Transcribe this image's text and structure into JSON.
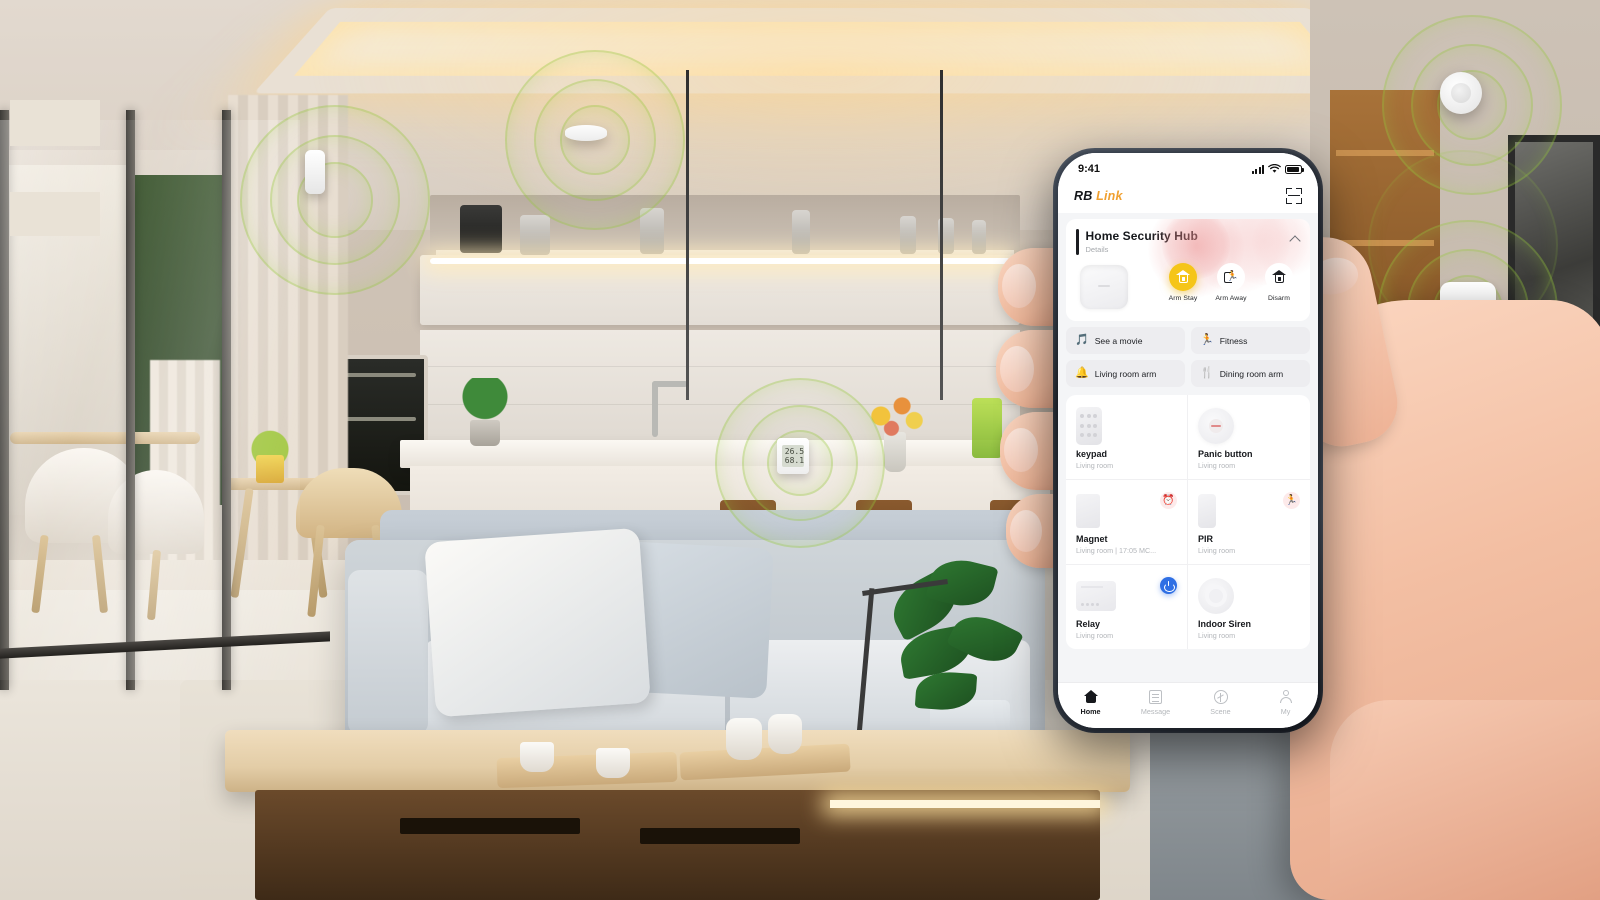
{
  "scene": {
    "description": "Modern living room with smart home sensors",
    "sensors": [
      {
        "name": "door-window-sensor",
        "location": "left wall"
      },
      {
        "name": "smoke-detector",
        "location": "ceiling"
      },
      {
        "name": "temperature-humidity-sensor",
        "location": "kitchen counter",
        "display": "26.5\n68.1"
      },
      {
        "name": "motion-sensor",
        "location": "right wall upper"
      },
      {
        "name": "wall-panel-sensor",
        "location": "right wall lower"
      }
    ],
    "accent_ring_color": "#96c83c"
  },
  "phone": {
    "status_bar": {
      "time": "9:41",
      "signal_icon": "cellular-signal-icon",
      "wifi_icon": "wifi-icon",
      "battery_icon": "battery-full-icon"
    },
    "header": {
      "brand_prefix": "RB",
      "brand_suffix": " Link",
      "scan_icon": "scan-qr-icon"
    },
    "hub": {
      "title": "Home Security Hub",
      "subtitle": "Details",
      "collapse_icon": "chevron-up-icon",
      "device_icon": "hub-device-icon",
      "modes": [
        {
          "label": "Arm Stay",
          "icon": "house-shield-icon",
          "active": true
        },
        {
          "label": "Arm Away",
          "icon": "running-person-icon",
          "active": false
        },
        {
          "label": "Disarm",
          "icon": "house-unlock-icon",
          "active": false
        }
      ],
      "active_color": "#f5c518"
    },
    "scenes": [
      {
        "label": "See a movie",
        "emoji": "🎵",
        "icon": "music-note-icon"
      },
      {
        "label": "Fitness",
        "emoji": "🏃",
        "icon": "fitness-icon"
      },
      {
        "label": "Living room arm",
        "emoji": "🔔",
        "icon": "bell-icon"
      },
      {
        "label": "Dining room arm",
        "emoji": "🍴",
        "icon": "cutlery-icon"
      }
    ],
    "devices": [
      {
        "name": "keypad",
        "location": "Living room",
        "art": "keypad",
        "badge": null
      },
      {
        "name": "Panic button",
        "location": "Living room",
        "art": "panic",
        "badge": null
      },
      {
        "name": "Magnet",
        "location": "Living room | 17:05 MC...",
        "art": "magnet",
        "badge": "alarm",
        "badge_icon": "alarm-bell-icon",
        "badge_emoji": "⏰"
      },
      {
        "name": "PIR",
        "location": "Living room",
        "art": "pir",
        "badge": "motion",
        "badge_icon": "motion-running-icon",
        "badge_emoji": "🏃"
      },
      {
        "name": "Relay",
        "location": "Living room",
        "art": "relay",
        "badge": "power",
        "badge_icon": "power-toggle-icon"
      },
      {
        "name": "Indoor Siren",
        "location": "Living room",
        "art": "siren",
        "badge": null
      }
    ],
    "tabs": [
      {
        "label": "Home",
        "icon": "home-icon",
        "active": true
      },
      {
        "label": "Message",
        "icon": "message-icon",
        "active": false
      },
      {
        "label": "Scene",
        "icon": "scene-icon",
        "active": false
      },
      {
        "label": "My",
        "icon": "profile-icon",
        "active": false
      }
    ]
  }
}
